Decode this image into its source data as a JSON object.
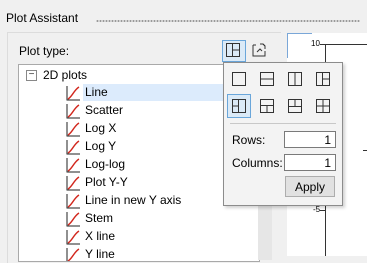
{
  "panel": {
    "title": "Plot Assistant",
    "plot_type_label": "Plot type:"
  },
  "tree": {
    "group": {
      "label": "2D plots",
      "expander": "−"
    },
    "items": [
      {
        "label": "Line",
        "selected": true
      },
      {
        "label": "Scatter"
      },
      {
        "label": "Log X"
      },
      {
        "label": "Log Y"
      },
      {
        "label": "Log-log"
      },
      {
        "label": "Plot Y-Y"
      },
      {
        "label": "Line in new Y axis"
      },
      {
        "label": "Stem"
      },
      {
        "label": "X line"
      },
      {
        "label": "Y line"
      }
    ]
  },
  "preview": {
    "y_ticks": [
      "10",
      "-5"
    ]
  },
  "layout_popup": {
    "rows_label": "Rows:",
    "rows_value": "1",
    "columns_label": "Columns:",
    "columns_value": "1",
    "apply_label": "Apply",
    "selected_layout": "one-top-two-bottom"
  },
  "colors": {
    "selection": "#dcebfc",
    "accent_border": "#6aa6da",
    "plot_icon_red": "#d2281e"
  }
}
